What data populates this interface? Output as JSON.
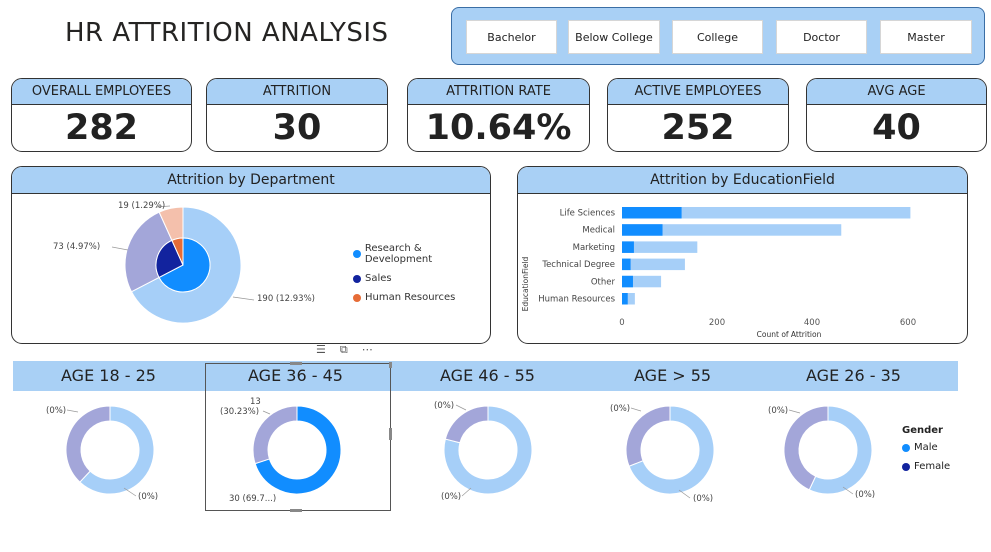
{
  "title": "HR ATTRITION ANALYSIS",
  "slicer": {
    "options": [
      "Bachelor",
      "Below College",
      "College",
      "Doctor",
      "Master"
    ]
  },
  "kpis": [
    {
      "label": "OVERALL EMPLOYEES",
      "value": "282"
    },
    {
      "label": "ATTRITION",
      "value": "30"
    },
    {
      "label": "ATTRITION RATE",
      "value": "10.64%"
    },
    {
      "label": "ACTIVE EMPLOYEES",
      "value": "252"
    },
    {
      "label": "AVG AGE",
      "value": "40"
    }
  ],
  "dept_chart": {
    "title": "Attrition by Department",
    "labels": [
      "190 (12.93%)",
      "73 (4.97%)",
      "19 (1.29%)"
    ],
    "legend": [
      "Research & Development",
      "Sales",
      "Human Resources"
    ]
  },
  "edu_chart": {
    "title": "Attrition by EducationField",
    "ylabel": "EducationField",
    "xlabel": "Count of Attrition",
    "ticks": [
      "0",
      "200",
      "400",
      "600"
    ]
  },
  "age_tabs": [
    "AGE 18 - 25",
    "AGE 36 - 45",
    "AGE 46 - 55",
    "AGE > 55",
    "AGE 26 - 35"
  ],
  "age_donuts": {
    "d1": [
      "(0%)",
      "(0%)"
    ],
    "d2": [
      "13",
      "(30.23%)",
      "30 (69.7...)"
    ],
    "d3": [
      "(0%)",
      "(0%)"
    ],
    "d4": [
      "(0%)",
      "(0%)"
    ],
    "d5": [
      "(0%)",
      "(0%)"
    ]
  },
  "gender_legend": {
    "title": "Gender",
    "items": [
      "Male",
      "Female"
    ]
  },
  "colors": {
    "accent": "#a9d0f5",
    "light_blue": "#a6cff8",
    "blue": "#118dff",
    "navy": "#12239e",
    "orange": "#e66c37",
    "lavender": "#a3a6d9",
    "peach": "#f4c0ac"
  },
  "chart_data": [
    {
      "type": "pie",
      "title": "Attrition by Department",
      "categories": [
        "Research & Development",
        "Sales",
        "Human Resources"
      ],
      "values": [
        190,
        73,
        19
      ]
    },
    {
      "type": "bar",
      "title": "Attrition by EducationField",
      "xlabel": "Count of Attrition",
      "ylabel": "EducationField",
      "categories": [
        "Life Sciences",
        "Medical",
        "Marketing",
        "Technical Degree",
        "Other",
        "Human Resources"
      ],
      "series": [
        {
          "values": [
            125,
            85,
            25,
            18,
            23,
            12
          ]
        },
        {
          "values": [
            605,
            460,
            158,
            132,
            82,
            27
          ]
        }
      ],
      "xlim": [
        0,
        650
      ]
    }
  ]
}
